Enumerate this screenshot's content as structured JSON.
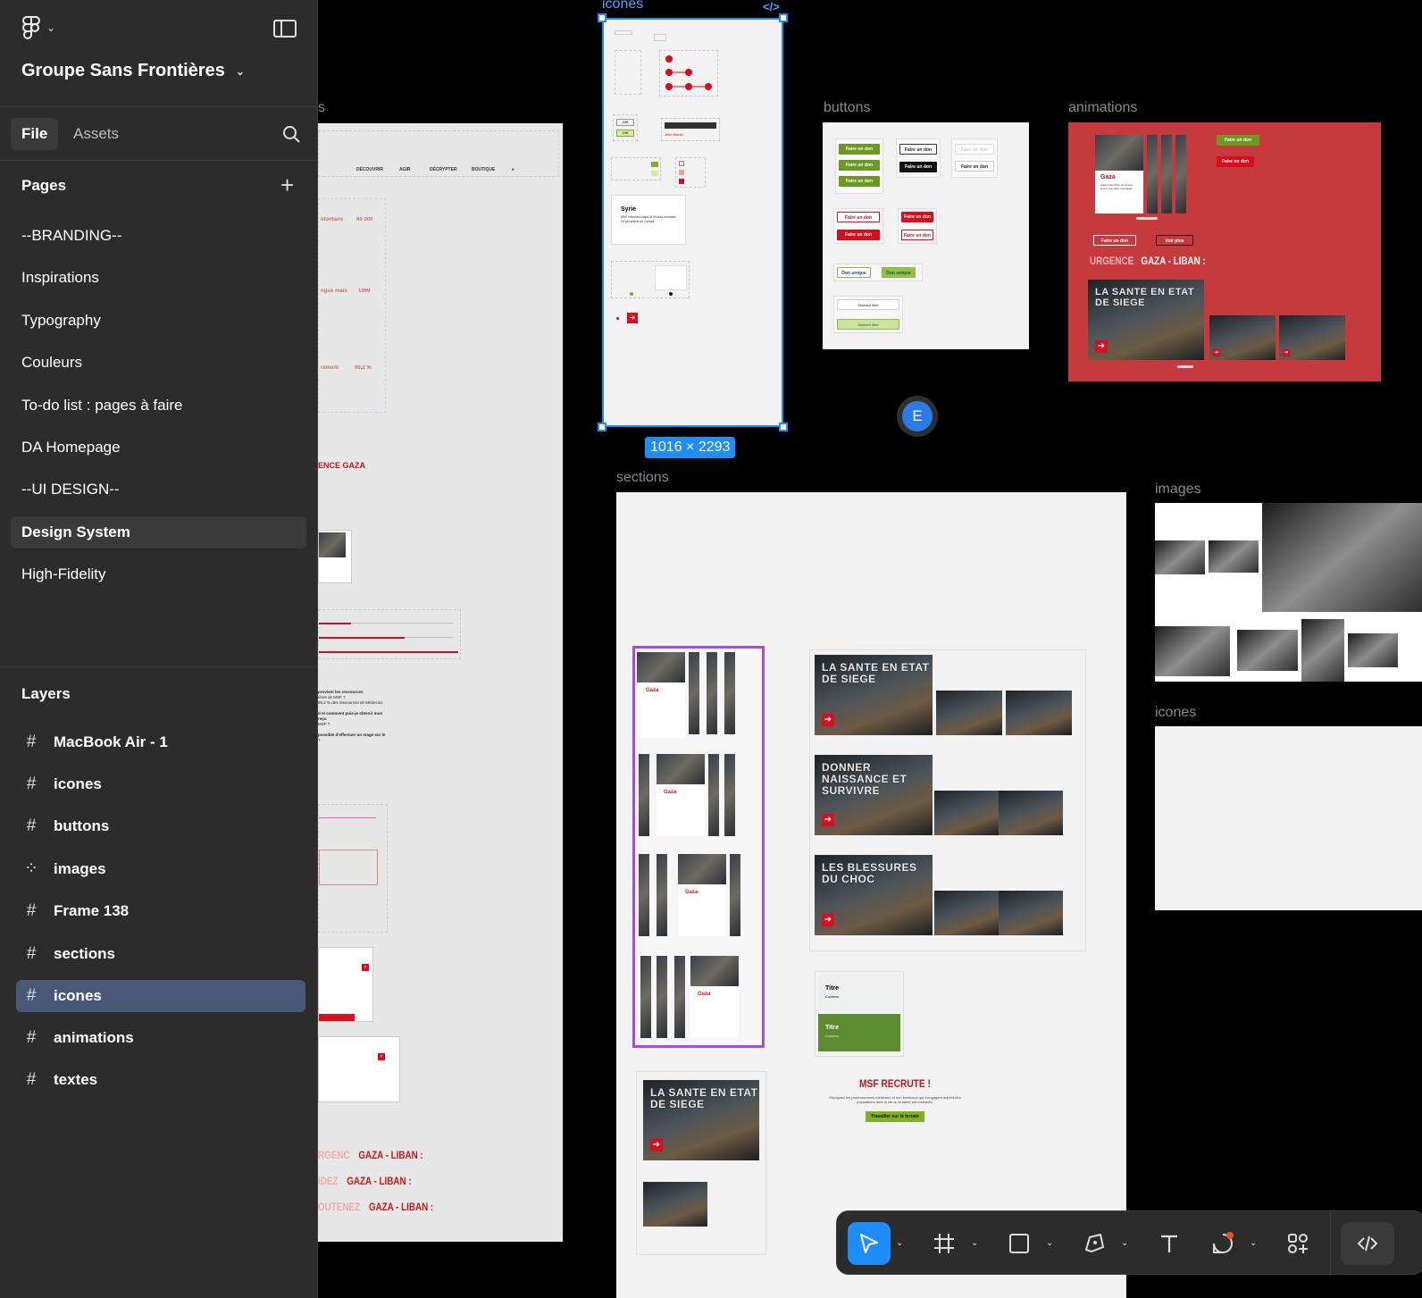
{
  "project": {
    "name": "Groupe Sans Frontières"
  },
  "tabs": {
    "file": "File",
    "assets": "Assets"
  },
  "pages": {
    "title": "Pages",
    "items": [
      "--BRANDING--",
      "Inspirations",
      "Typography",
      "Couleurs",
      "To-do list : pages à faire",
      "DA Homepage",
      "--UI DESIGN--",
      "Design System",
      "High-Fidelity"
    ],
    "active_index": 7
  },
  "layers": {
    "title": "Layers",
    "items": [
      {
        "label": "MacBook Air - 1",
        "icon": "frame-icon"
      },
      {
        "label": "icones",
        "icon": "frame-icon"
      },
      {
        "label": "buttons",
        "icon": "frame-icon"
      },
      {
        "label": "images",
        "icon": "grid-icon"
      },
      {
        "label": "Frame 138",
        "icon": "frame-icon"
      },
      {
        "label": "sections",
        "icon": "frame-icon"
      },
      {
        "label": "icones",
        "icon": "frame-icon"
      },
      {
        "label": "animations",
        "icon": "frame-icon"
      },
      {
        "label": "textes",
        "icon": "frame-icon"
      }
    ],
    "active_index": 6
  },
  "canvas": {
    "labels": {
      "icones_top": "icones",
      "buttons": "buttons",
      "animations": "animations",
      "sections": "sections",
      "images": "images",
      "icones_bottom": "icones",
      "left_partial": "s"
    },
    "selection_size": "1016 × 2293",
    "avatar_initial": "E"
  },
  "left_frame": {
    "nav_items": [
      "DÉCOUVRIR",
      "AGIR",
      "DÉCRYPTER",
      "BOUTIQUE"
    ],
    "stats": [
      "olontaire",
      "60 000",
      "ngue mais",
      "1999",
      "rement",
      "99,2 %"
    ],
    "urgence_title": "ENCE GAZA",
    "urgence_rows": [
      {
        "word": "RGENC",
        "place": "GAZA - LIBAN :"
      },
      {
        "word": "IDEZ",
        "place": "GAZA - LIBAN :"
      },
      {
        "word": "OUTENEZ",
        "place": "GAZA - LIBAN :"
      }
    ]
  },
  "icones_frame": {
    "card_title": "Syrie",
    "card_text": "MSF intervient dans la Ghouta orientale, en périphérie de Damas."
  },
  "buttons_frame": {
    "labels": [
      "Faire un don",
      "Faire un don",
      "Faire un don",
      "Faire un don",
      "Faire un don",
      "Faire un don",
      "Faire un don",
      "Faire un don",
      "Faire un don",
      "Faire un don",
      "Don unique",
      "Don unique",
      "Montant libre",
      "Montant libre"
    ]
  },
  "animations_frame": {
    "card_title": "Gaza",
    "btn_green": "Faire un don",
    "btn_red": "Faire un don",
    "btn_outline1": "Faire un don",
    "btn_outline2": "Voir plus",
    "urgence": "URGENCE",
    "place": "GAZA - LIBAN :",
    "hero_title": "LA SANTE EN ETAT DE SIEGE"
  },
  "sections_frame": {
    "hero_titles": [
      "LA SANTE EN ETAT DE SIEGE",
      "DONNER NAISSANCE ET SURVIVRE",
      "LES BLESSURES DU CHOC"
    ],
    "mini_titles": [
      "Titre",
      "Titre"
    ],
    "mini_sub": "Contenu",
    "recrute_title": "MSF RECRUTE !",
    "recrute_text": "Rejoignez les professionnels médicaux et non médicaux qui s'engagent auprès des populations dont la vie ou la santé est menacée.",
    "recrute_btn": "Travailler sur le terrain",
    "gaza": "Gaza"
  },
  "colors": {
    "accent": "#1f8cf8",
    "brand_red": "#d90d1d",
    "brand_green": "#7fb21f",
    "sidebar": "#2c2c2c"
  }
}
